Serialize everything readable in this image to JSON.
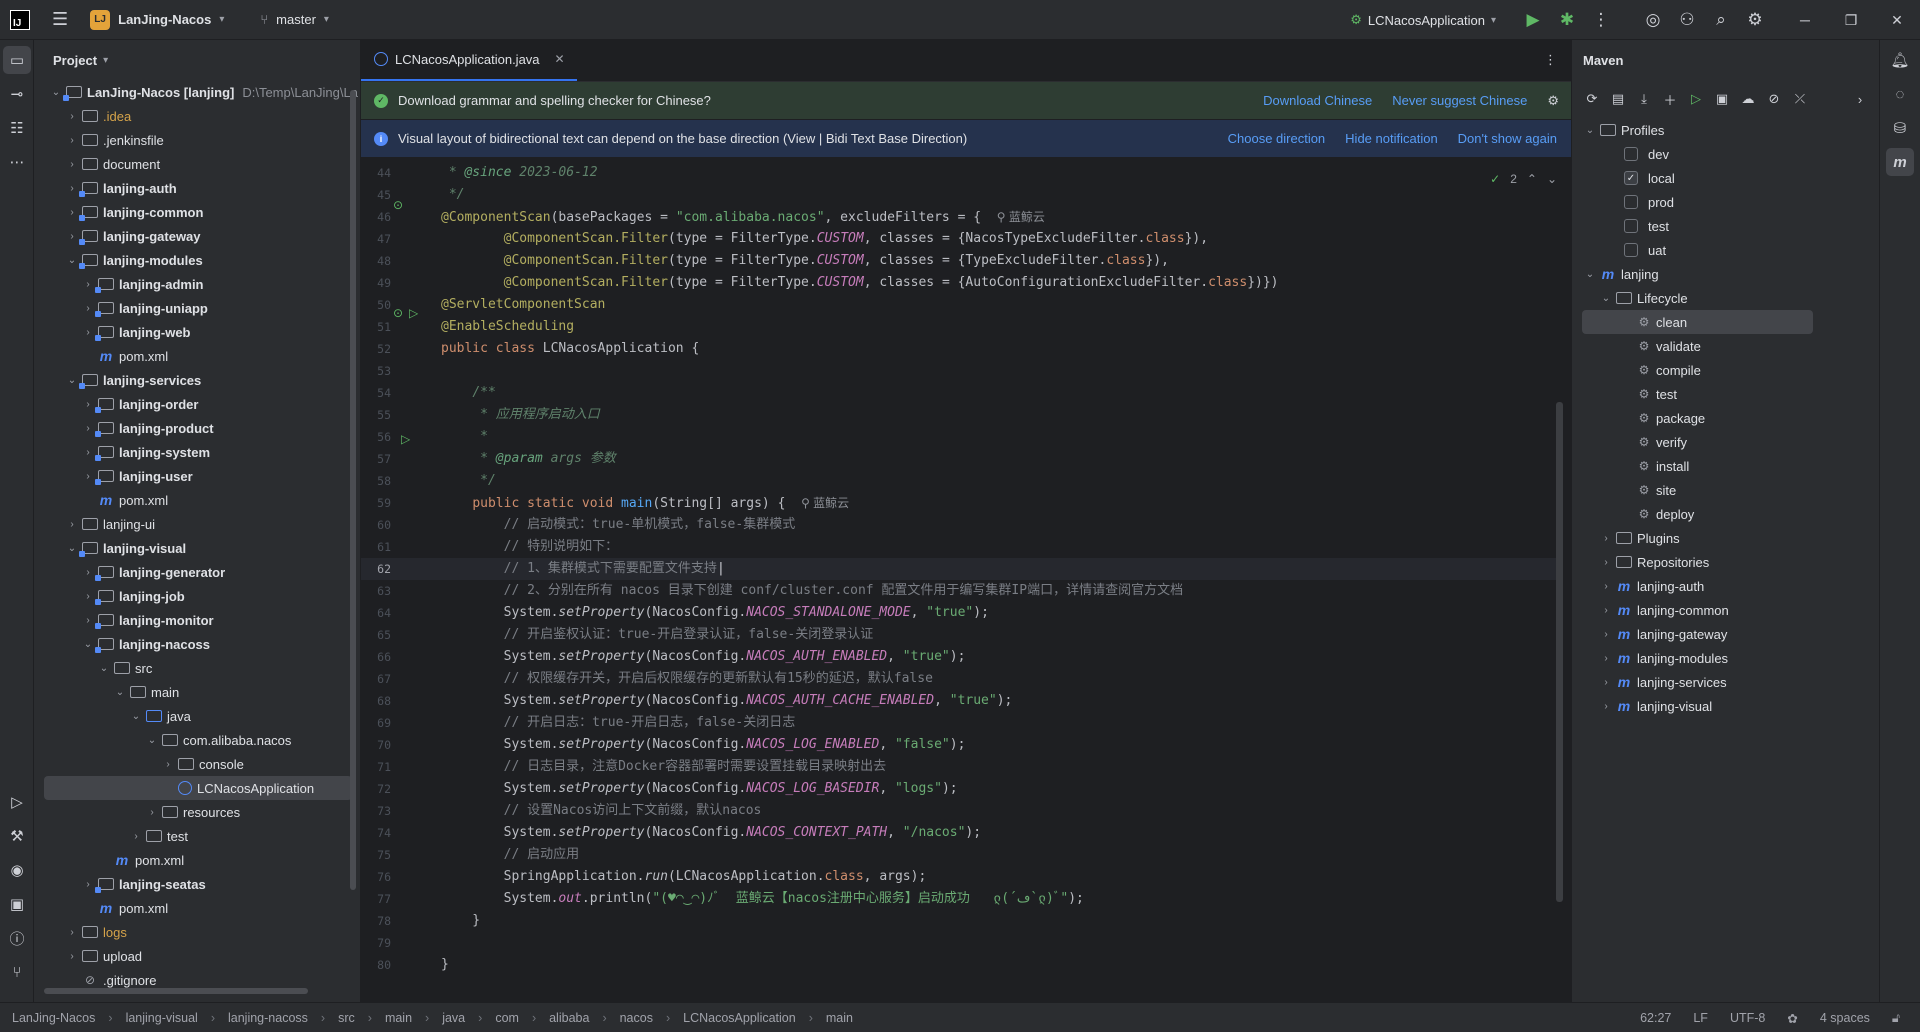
{
  "titlebar": {
    "project_badge": "LJ",
    "project_name": "LanJing-Nacos",
    "branch": "master",
    "run_config": "LCNacosApplication"
  },
  "project_panel": {
    "title": "Project",
    "root_label": "LanJing-Nacos [lanjing]",
    "root_path": "D:\\Temp\\LanJing\\La",
    "items": [
      {
        "label": ".idea"
      },
      {
        "label": ".jenkinsfile"
      },
      {
        "label": "document"
      },
      {
        "label": "lanjing-auth"
      },
      {
        "label": "lanjing-common"
      },
      {
        "label": "lanjing-gateway"
      },
      {
        "label": "lanjing-modules"
      },
      {
        "label": "lanjing-admin"
      },
      {
        "label": "lanjing-uniapp"
      },
      {
        "label": "lanjing-web"
      },
      {
        "label": "pom.xml"
      },
      {
        "label": "lanjing-services"
      },
      {
        "label": "lanjing-order"
      },
      {
        "label": "lanjing-product"
      },
      {
        "label": "lanjing-system"
      },
      {
        "label": "lanjing-user"
      },
      {
        "label": "pom.xml"
      },
      {
        "label": "lanjing-ui"
      },
      {
        "label": "lanjing-visual"
      },
      {
        "label": "lanjing-generator"
      },
      {
        "label": "lanjing-job"
      },
      {
        "label": "lanjing-monitor"
      },
      {
        "label": "lanjing-nacoss"
      },
      {
        "label": "src"
      },
      {
        "label": "main"
      },
      {
        "label": "java"
      },
      {
        "label": "com.alibaba.nacos"
      },
      {
        "label": "console"
      },
      {
        "label": "LCNacosApplication"
      },
      {
        "label": "resources"
      },
      {
        "label": "test"
      },
      {
        "label": "pom.xml"
      },
      {
        "label": "lanjing-seatas"
      },
      {
        "label": "pom.xml"
      },
      {
        "label": "logs"
      },
      {
        "label": "upload"
      },
      {
        "label": ".gitignore"
      }
    ]
  },
  "editor": {
    "tab_label": "LCNacosApplication.java",
    "notif1": {
      "text": "Download grammar and spelling checker for Chinese?",
      "link1": "Download Chinese",
      "link2": "Never suggest Chinese"
    },
    "notif2": {
      "text": "Visual layout of bidirectional text can depend on the base direction (View | Bidi Text Base Direction)",
      "link1": "Choose direction",
      "link2": "Hide notification",
      "link3": "Don't show again"
    },
    "inspection_count": "2",
    "author_hint": "蓝鲸云",
    "line_numbers": [
      "44",
      "45",
      "46",
      "47",
      "48",
      "49",
      "50",
      "51",
      "52",
      "53",
      "54",
      "55",
      "56",
      "57",
      "58",
      "59",
      "60",
      "61",
      "62",
      "63",
      "64",
      "65",
      "66",
      "67",
      "68",
      "69",
      "70",
      "71",
      "72",
      "73",
      "74",
      "75",
      "76",
      "77",
      "78",
      "79",
      "80"
    ]
  },
  "maven": {
    "title": "Maven",
    "profiles_label": "Profiles",
    "profiles": [
      {
        "name": "dev",
        "checked": false
      },
      {
        "name": "local",
        "checked": true
      },
      {
        "name": "prod",
        "checked": false
      },
      {
        "name": "test",
        "checked": false
      },
      {
        "name": "uat",
        "checked": false
      }
    ],
    "project": "lanjing",
    "lifecycle_label": "Lifecycle",
    "lifecycle": [
      "clean",
      "validate",
      "compile",
      "test",
      "package",
      "verify",
      "install",
      "site",
      "deploy"
    ],
    "plugins": "Plugins",
    "repositories": "Repositories",
    "modules": [
      "lanjing-auth",
      "lanjing-common",
      "lanjing-gateway",
      "lanjing-modules",
      "lanjing-services",
      "lanjing-visual"
    ]
  },
  "statusbar": {
    "crumbs": [
      "LanJing-Nacos",
      "lanjing-visual",
      "lanjing-nacoss",
      "src",
      "main",
      "java",
      "com",
      "alibaba",
      "nacos",
      "LCNacosApplication",
      "main"
    ],
    "position": "62:27",
    "line_sep": "LF",
    "encoding": "UTF-8",
    "indent": "4 spaces"
  }
}
